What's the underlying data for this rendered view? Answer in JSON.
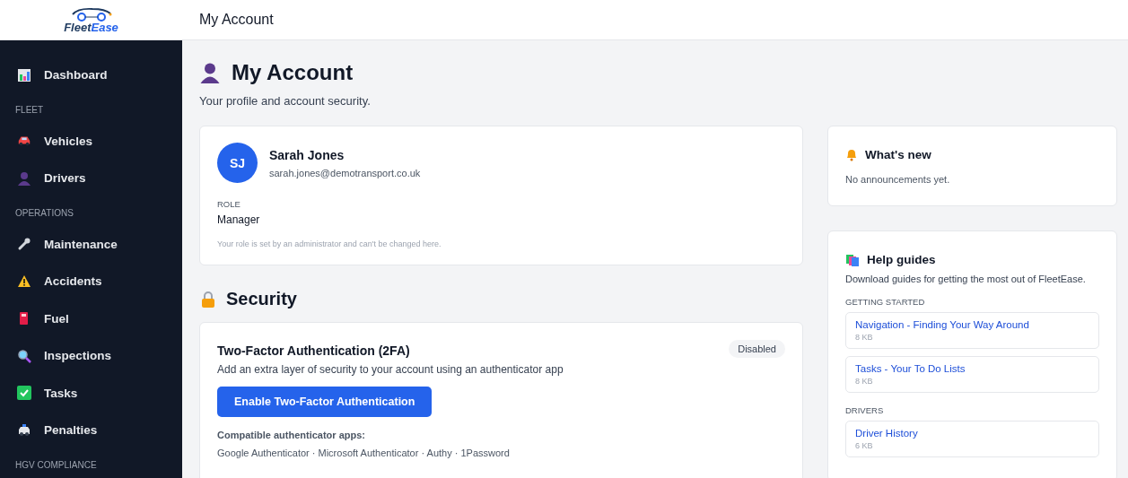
{
  "logo": {
    "text_left": "Fleet",
    "text_right": "Ease"
  },
  "header": {
    "title": "My Account"
  },
  "sidebar": {
    "items": [
      {
        "kind": "item",
        "label": "Dashboard"
      },
      {
        "kind": "section",
        "label": "FLEET"
      },
      {
        "kind": "item",
        "label": "Vehicles"
      },
      {
        "kind": "item",
        "label": "Drivers"
      },
      {
        "kind": "section",
        "label": "OPERATIONS"
      },
      {
        "kind": "item",
        "label": "Maintenance"
      },
      {
        "kind": "item",
        "label": "Accidents"
      },
      {
        "kind": "item",
        "label": "Fuel"
      },
      {
        "kind": "item",
        "label": "Inspections"
      },
      {
        "kind": "item",
        "label": "Tasks"
      },
      {
        "kind": "item",
        "label": "Penalties"
      },
      {
        "kind": "section",
        "label": "HGV COMPLIANCE"
      }
    ]
  },
  "page": {
    "title": "My Account",
    "subtitle": "Your profile and account security."
  },
  "profile": {
    "initials": "SJ",
    "name": "Sarah Jones",
    "email": "sarah.jones@demotransport.co.uk",
    "role_label": "ROLE",
    "role": "Manager",
    "note": "Your role is set by an administrator and can't be changed here."
  },
  "security": {
    "title": "Security",
    "card_title": "Two-Factor Authentication (2FA)",
    "status": "Disabled",
    "description": "Add an extra layer of security to your account using an authenticator app",
    "button": "Enable Two-Factor Authentication",
    "apps_label": "Compatible authenticator apps:",
    "apps": "Google Authenticator · Microsoft Authenticator · Authy · 1Password"
  },
  "whats_new": {
    "title": "What's new",
    "text": "No announcements yet."
  },
  "help": {
    "title": "Help guides",
    "description": "Download guides for getting the most out of FleetEase.",
    "groups": [
      {
        "label": "GETTING STARTED",
        "guides": [
          {
            "title": "Navigation - Finding Your Way Around",
            "size": "8 KB"
          },
          {
            "title": "Tasks - Your To Do Lists",
            "size": "8 KB"
          }
        ]
      },
      {
        "label": "DRIVERS",
        "guides": [
          {
            "title": "Driver History",
            "size": "6 KB"
          }
        ]
      }
    ]
  }
}
